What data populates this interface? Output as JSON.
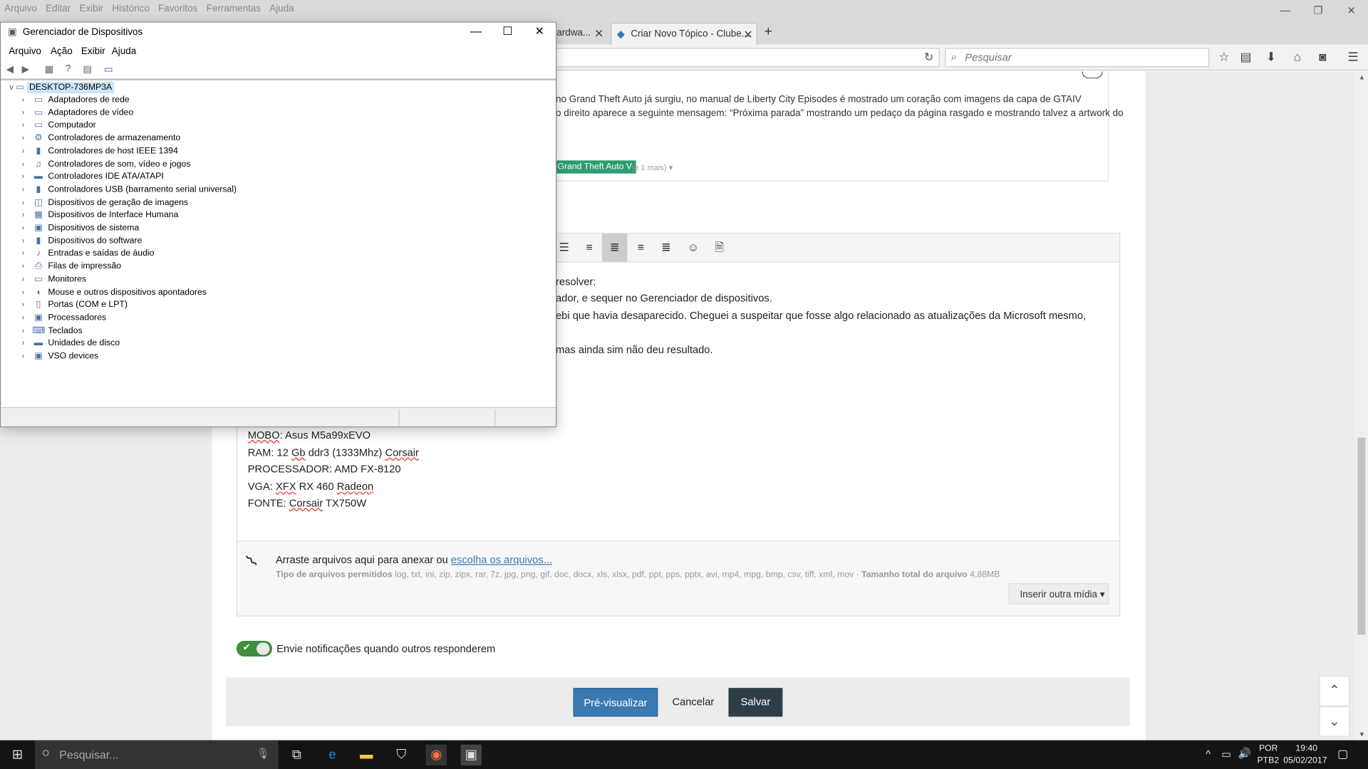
{
  "firefox": {
    "menu": [
      "Arquivo",
      "Editar",
      "Exibir",
      "Histórico",
      "Favoritos",
      "Ferramentas",
      "Ajuda"
    ],
    "tabs": [
      {
        "label": "ardwa..."
      },
      {
        "label": "Criar Novo Tópico - Clube..."
      }
    ],
    "search_placeholder": "Pesquisar"
  },
  "page": {
    "post_line1": "no Grand Theft Auto já surgiu, no manual de Liberty City Episodes é mostrado um coração com imagens da capa de GTAIV",
    "post_line2": "o direito aparece a seguinte mensagem: “Próxima parada” mostrando um pedaço da página rasgado e mostrando talvez a artwork do",
    "tag": "Grand Theft Auto V",
    "tag_more": "(e 1 mais)",
    "editor_lines": [
      "resolver:",
      "ador, e sequer no Gerenciador de dispositivos.",
      "ebi que havia desaparecido. Cheguei a suspeitar que fosse algo relacionado as atualizações da Microsoft mesmo,",
      "mas ainda sim não deu resultado."
    ],
    "specs": {
      "mobo_label": "MOBO",
      "mobo_value": ": Asus M5a99xEVO",
      "ram_prefix": "RAM: 12 ",
      "ram_gb": "Gb",
      "ram_mid": " ddr3 (1333Mhz) ",
      "ram_brand": "Corsair",
      "cpu": "PROCESSADOR: AMD FX-8120",
      "vga_prefix": "VGA: ",
      "vga_xfx": "XFX",
      "vga_mid": " RX 460 ",
      "vga_radeon": "Radeon",
      "psu_prefix": "FONTE: ",
      "psu_brand": "Corsair",
      "psu_model": " TX750W"
    },
    "attach": {
      "text": "Arraste arquivos aqui para anexar ou",
      "link": "escolha os arquivos...",
      "types_label": "Tipo de arquivos permitidos",
      "types": "log, txt, ini, zip, zipx, rar, 7z, jpg, png, gif, doc, docx, xls, xlsx, pdf, ppt, pps, pptx, avi, mp4, mpg, bmp, csv, tiff, xml, mov",
      "size_label": "Tamanho total do arquivo",
      "size": "4,88MB",
      "media_button": "Inserir outra mídia"
    },
    "notify_label": "Envie notificações quando outros responderem",
    "buttons": {
      "preview": "Pré-visualizar",
      "cancel": "Cancelar",
      "save": "Salvar"
    }
  },
  "device_manager": {
    "title": "Gerenciador de Dispositivos",
    "menu": [
      "Arquivo",
      "Ação",
      "Exibir",
      "Ajuda"
    ],
    "root": "DESKTOP-736MP3A",
    "items": [
      {
        "label": "Adaptadores de rede",
        "icon": "network-adapter-icon"
      },
      {
        "label": "Adaptadores de vídeo",
        "icon": "display-adapter-icon"
      },
      {
        "label": "Computador",
        "icon": "computer-icon"
      },
      {
        "label": "Controladores de armazenamento",
        "icon": "storage-controller-icon"
      },
      {
        "label": "Controladores de host IEEE 1394",
        "icon": "ieee1394-icon"
      },
      {
        "label": "Controladores de som, vídeo e jogos",
        "icon": "sound-icon"
      },
      {
        "label": "Controladores IDE ATA/ATAPI",
        "icon": "ide-icon"
      },
      {
        "label": "Controladores USB (barramento serial universal)",
        "icon": "usb-icon"
      },
      {
        "label": "Dispositivos de geração de imagens",
        "icon": "imaging-icon"
      },
      {
        "label": "Dispositivos de Interface Humana",
        "icon": "hid-icon"
      },
      {
        "label": "Dispositivos de sistema",
        "icon": "system-device-icon"
      },
      {
        "label": "Dispositivos do software",
        "icon": "software-device-icon"
      },
      {
        "label": "Entradas e saídas de áudio",
        "icon": "audio-io-icon"
      },
      {
        "label": "Filas de impressão",
        "icon": "printer-icon"
      },
      {
        "label": "Monitores",
        "icon": "monitor-icon"
      },
      {
        "label": "Mouse e outros dispositivos apontadores",
        "icon": "mouse-icon"
      },
      {
        "label": "Portas (COM e LPT)",
        "icon": "port-icon"
      },
      {
        "label": "Processadores",
        "icon": "processor-icon"
      },
      {
        "label": "Teclados",
        "icon": "keyboard-icon"
      },
      {
        "label": "Unidades de disco",
        "icon": "disk-drive-icon"
      },
      {
        "label": "VSO devices",
        "icon": "vso-device-icon"
      }
    ]
  },
  "taskbar": {
    "search_placeholder": "Pesquisar...",
    "lang_top": "POR",
    "lang_bottom": "PTB2",
    "time": "19:40",
    "date": "05/02/2017"
  },
  "colors": {
    "accent_blue": "#3a7ab3",
    "save_dark": "#2f3e46",
    "tag_green": "#2e9d6e",
    "toggle_green": "#3f8f3f"
  }
}
